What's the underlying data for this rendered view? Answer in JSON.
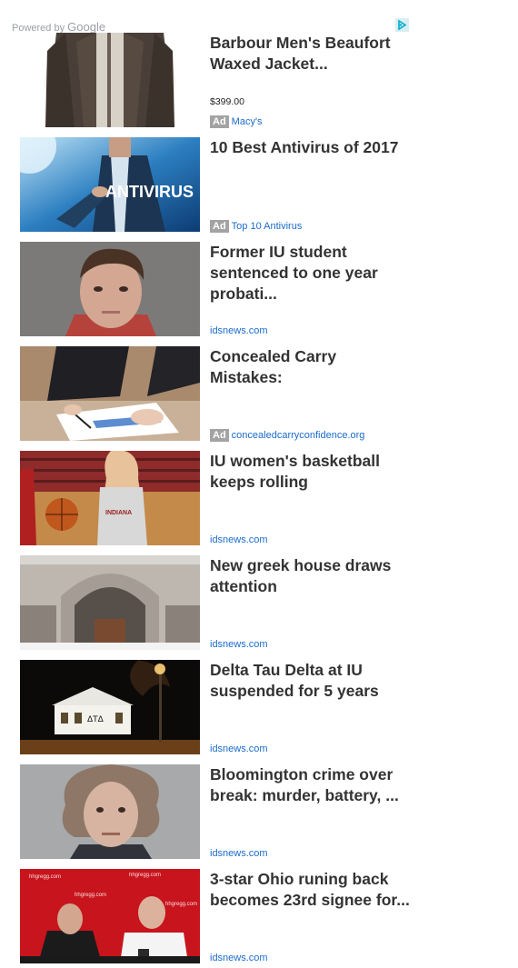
{
  "header": {
    "powered_by": "Powered by",
    "brand": "Google"
  },
  "items": [
    {
      "title": "Barbour Men's Beaufort Waxed Jacket...",
      "price": "$399.00",
      "ad_label": "Ad",
      "source": "Macy's",
      "is_ad": true,
      "thumb": "brown-waxed-jacket"
    },
    {
      "title": "10 Best Antivirus of 2017",
      "ad_label": "Ad",
      "source": "Top 10 Antivirus",
      "is_ad": true,
      "thumb": "antivirus-businessman",
      "thumb_text": "ANTIVIRUS"
    },
    {
      "title": "Former IU student sentenced to one year probati...",
      "source": "idsnews.com",
      "is_ad": false,
      "thumb": "young-man-mugshot"
    },
    {
      "title": "Concealed Carry Mistakes:",
      "ad_label": "Ad",
      "source": "concealedcarryconfidence.org",
      "is_ad": true,
      "thumb": "signing-document"
    },
    {
      "title": "IU women's basketball keeps rolling",
      "source": "idsnews.com",
      "is_ad": false,
      "thumb": "basketball-player"
    },
    {
      "title": "New greek house draws attention",
      "source": "idsnews.com",
      "is_ad": false,
      "thumb": "stone-arch-building"
    },
    {
      "title": "Delta Tau Delta at IU suspended for 5 years",
      "source": "idsnews.com",
      "is_ad": false,
      "thumb": "fraternity-house-night",
      "thumb_text": "ΔΤΔ"
    },
    {
      "title": "Bloomington crime over break: murder, battery, ...",
      "source": "idsnews.com",
      "is_ad": false,
      "thumb": "wild-hair-mugshot"
    },
    {
      "title": "3-star Ohio runing back becomes 23rd signee for...",
      "source": "idsnews.com",
      "is_ad": false,
      "thumb": "press-conference-coaches",
      "thumb_text": "hhgregg.com"
    }
  ],
  "colors": {
    "link": "#1a6bcc",
    "title": "#333333",
    "ad_badge": "#a3a3a3"
  }
}
